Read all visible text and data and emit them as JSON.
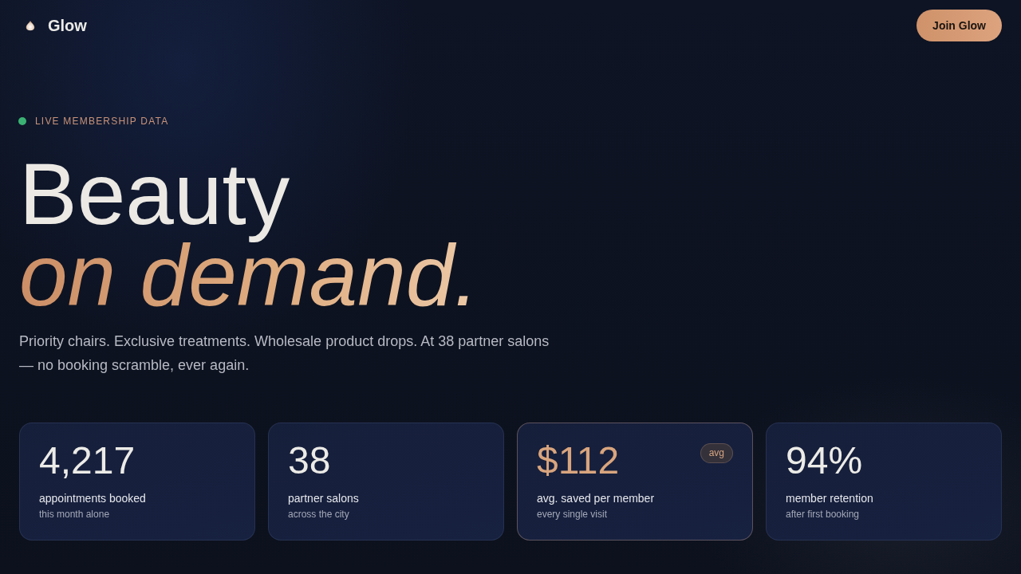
{
  "header": {
    "brand": "Glow",
    "cta": "Join Glow"
  },
  "hero": {
    "eyebrow": "LIVE MEMBERSHIP DATA",
    "title_line_1": "Beauty",
    "title_line_2": "on demand.",
    "lead": "Priority chairs. Exclusive treatments. Wholesale product drops. At 38 partner salons — no booking scramble, ever again."
  },
  "stats": [
    {
      "value": "4,217",
      "label": "appointments booked",
      "note": "this month alone",
      "highlighted": false
    },
    {
      "value": "38",
      "label": "partner salons",
      "note": "across the city",
      "highlighted": false
    },
    {
      "value": "$112",
      "label": "avg. saved per member",
      "note": "every single visit",
      "highlighted": true,
      "badge": "avg"
    },
    {
      "value": "94%",
      "label": "member retention",
      "note": "after first booking",
      "highlighted": false
    }
  ]
}
